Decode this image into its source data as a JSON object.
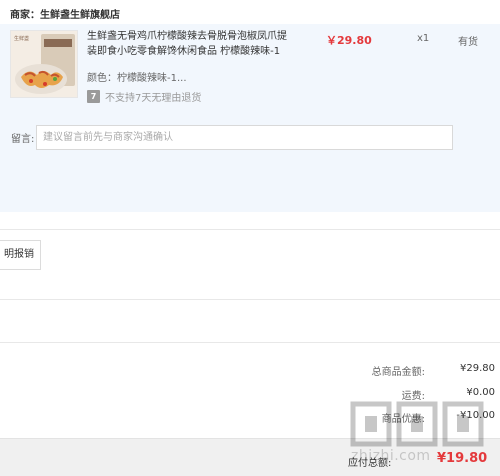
{
  "store": {
    "label": "商家：生鲜盏生鲜旗舰店"
  },
  "product": {
    "thumb_brand": "生鲜盏",
    "title": "生鲜盏无骨鸡爪柠檬酸辣去骨脱骨泡椒凤爪提装即食小吃零食解馋休闲食品 柠檬酸辣味-1",
    "price": "￥29.80",
    "quantity": "x1",
    "stock": "有货",
    "spec_label": "颜色：",
    "spec_value": "柠檬酸辣味-1...",
    "return_icon": "7",
    "return_policy": "不支持7天无理由退货"
  },
  "message": {
    "label": "留言:",
    "placeholder": "建议留言前先与商家沟通确认",
    "value": ""
  },
  "invoice": {
    "button_label": "明报销"
  },
  "summary": {
    "total_label": "总商品金额:",
    "total_value": "¥29.80",
    "shipping_label": "运费:",
    "shipping_value": "¥0.00",
    "discount_label": "商品优惠:",
    "discount_value": "-¥10.00"
  },
  "footer": {
    "pay_label": "应付总额:",
    "pay_value": "¥19.80"
  },
  "watermark": {
    "text": "zhizhi.com"
  },
  "colors": {
    "price_red": "#e4393c",
    "panel_bg": "#f2f7fd",
    "bottom_bar_bg": "#f0f0f0"
  }
}
